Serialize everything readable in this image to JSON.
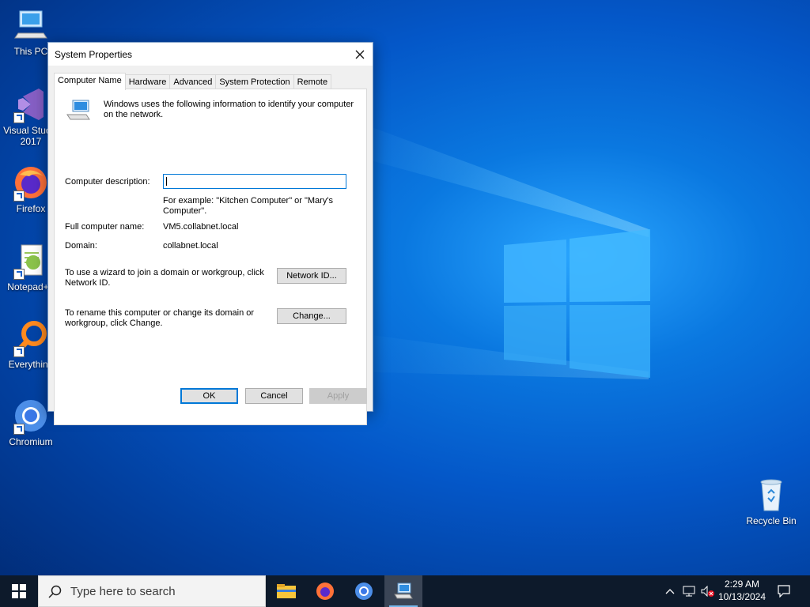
{
  "desktop": {
    "icons": [
      {
        "label": "This PC"
      },
      {
        "label": "Visual Studio\n2017"
      },
      {
        "label": "Firefox"
      },
      {
        "label": "Notepad++"
      },
      {
        "label": "Everything"
      },
      {
        "label": "Chromium"
      },
      {
        "label": "Recycle Bin"
      }
    ]
  },
  "window": {
    "title": "System Properties",
    "close_icon": "close-icon",
    "tabs": [
      {
        "label": "Computer Name",
        "active": true
      },
      {
        "label": "Hardware"
      },
      {
        "label": "Advanced"
      },
      {
        "label": "System Protection"
      },
      {
        "label": "Remote"
      }
    ],
    "intro": "Windows uses the following information to identify your computer on the network.",
    "description_label": "Computer description:",
    "description_value": "",
    "example": "For example: \"Kitchen Computer\" or \"Mary's Computer\".",
    "full_name_label": "Full computer name:",
    "full_name_value": "VM5.collabnet.local",
    "domain_label": "Domain:",
    "domain_value": "collabnet.local",
    "network_text": "To use a wizard to join a domain or workgroup, click Network ID.",
    "network_button": "Network ID...",
    "rename_text": "To rename this computer or change its domain or workgroup, click Change.",
    "change_button": "Change...",
    "ok_button": "OK",
    "cancel_button": "Cancel",
    "apply_button": "Apply"
  },
  "taskbar": {
    "search_placeholder": "Type here to search",
    "time": "2:29 AM",
    "date": "10/13/2024"
  },
  "colors": {
    "accent": "#0078d7",
    "taskbar": "#0d1a2b"
  }
}
